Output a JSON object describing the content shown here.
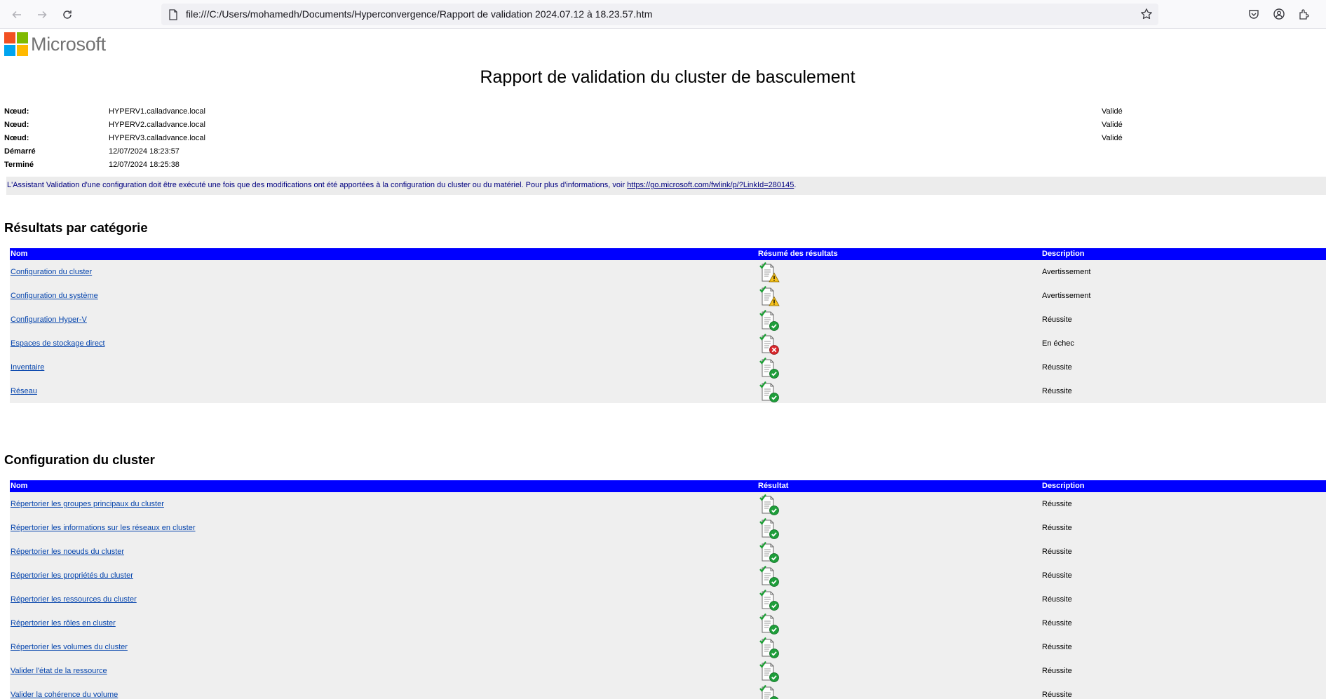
{
  "browser": {
    "url": "file:///C:/Users/mohamedh/Documents/Hyperconvergence/Rapport de validation 2024.07.12 à 18.23.57.htm"
  },
  "logo": {
    "text": "Microsoft"
  },
  "title": "Rapport de validation du cluster de basculement",
  "info": [
    {
      "label": "Nœud:",
      "value": "HYPERV1.calladvance.local",
      "status": "Validé"
    },
    {
      "label": "Nœud:",
      "value": "HYPERV2.calladvance.local",
      "status": "Validé"
    },
    {
      "label": "Nœud:",
      "value": "HYPERV3.calladvance.local",
      "status": "Validé"
    },
    {
      "label": "Démarré",
      "value": "12/07/2024 18:23:57",
      "status": ""
    },
    {
      "label": "Terminé",
      "value": "12/07/2024 18:25:38",
      "status": ""
    }
  ],
  "notice": {
    "text": "L'Assistant Validation d'une configuration doit être exécuté une fois que des modifications ont été apportées à la configuration du cluster ou du matériel. Pour plus d'informations, voir ",
    "link": "https://go.microsoft.com/fwlink/p/?LinkId=280145",
    "end": "."
  },
  "categories": {
    "title": "Résultats par catégorie",
    "headers": {
      "name": "Nom",
      "result": "Résumé des résultats",
      "description": "Description"
    },
    "rows": [
      {
        "name": "Configuration du cluster",
        "icon": "warning",
        "description": "Avertissement"
      },
      {
        "name": "Configuration du système",
        "icon": "warning",
        "description": "Avertissement"
      },
      {
        "name": "Configuration Hyper-V",
        "icon": "success",
        "description": "Réussite"
      },
      {
        "name": "Espaces de stockage direct",
        "icon": "failure",
        "description": "En échec"
      },
      {
        "name": "Inventaire",
        "icon": "success",
        "description": "Réussite"
      },
      {
        "name": "Réseau",
        "icon": "success",
        "description": "Réussite"
      }
    ]
  },
  "cluster": {
    "title": "Configuration du cluster",
    "headers": {
      "name": "Nom",
      "result": "Résultat",
      "description": "Description"
    },
    "rows": [
      {
        "name": "Répertorier les groupes principaux du cluster",
        "icon": "success",
        "description": "Réussite"
      },
      {
        "name": "Répertorier les informations sur les réseaux en cluster",
        "icon": "success",
        "description": "Réussite"
      },
      {
        "name": "Répertorier les noeuds du cluster",
        "icon": "success",
        "description": "Réussite"
      },
      {
        "name": "Répertorier les propriétés du cluster",
        "icon": "success",
        "description": "Réussite"
      },
      {
        "name": "Répertorier les ressources du cluster",
        "icon": "success",
        "description": "Réussite"
      },
      {
        "name": "Répertorier les rôles en cluster",
        "icon": "success",
        "description": "Réussite"
      },
      {
        "name": "Répertorier les volumes du cluster",
        "icon": "success",
        "description": "Réussite"
      },
      {
        "name": "Valider l'état de la ressource",
        "icon": "success",
        "description": "Réussite"
      },
      {
        "name": "Valider la cohérence du volume",
        "icon": "success",
        "description": "Réussite"
      }
    ]
  },
  "colors": {
    "header_bg": "#0000ff",
    "row_bg": "#efefef",
    "link": "#0645ad",
    "notice_text": "#000080"
  }
}
